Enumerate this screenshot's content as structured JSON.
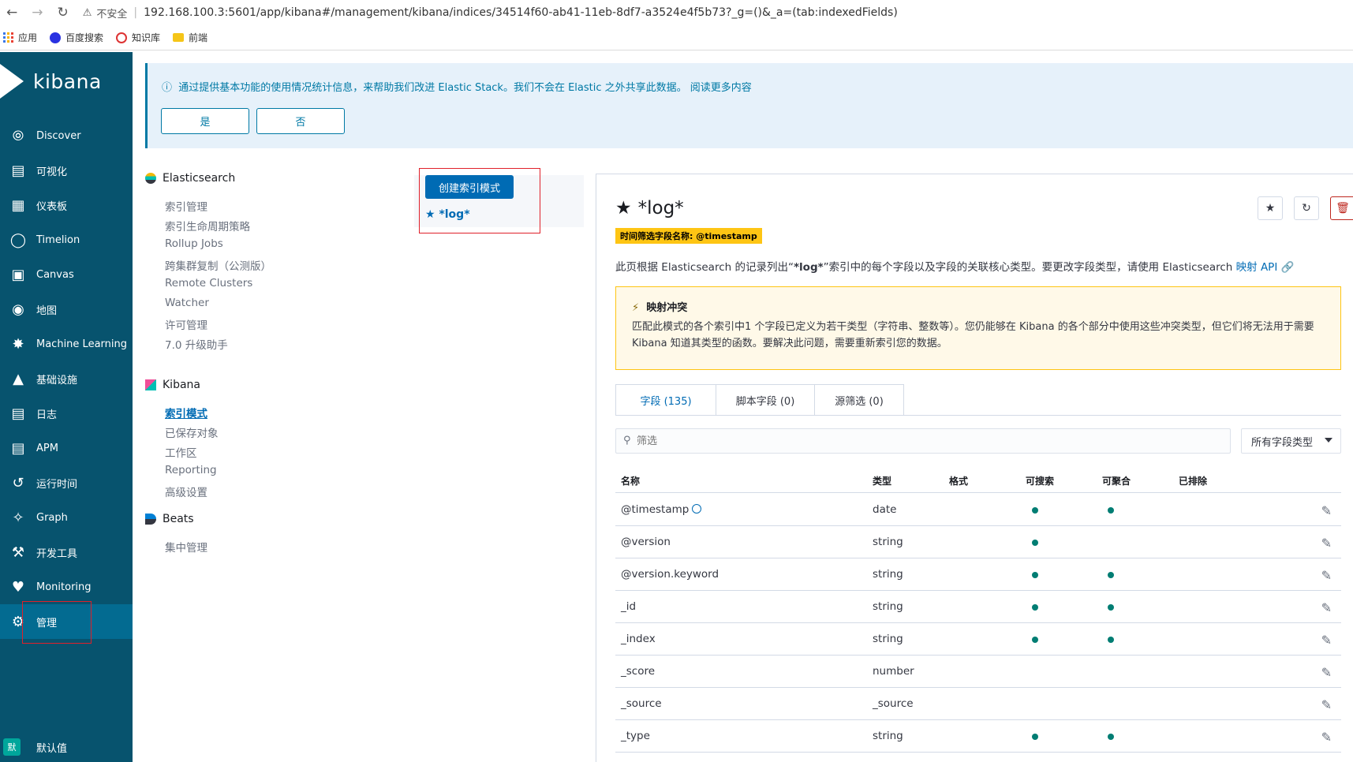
{
  "browser": {
    "insecure_label": "不安全",
    "url": "192.168.100.3:5601/app/kibana#/management/kibana/indices/34514f60-ab41-11eb-8df7-a3524e4f5b73?_g=()&_a=(tab:indexedFields)",
    "bookmarks": [
      "应用",
      "百度搜索",
      "知识库",
      "前端"
    ]
  },
  "sidebar": {
    "logo": "kibana",
    "items": [
      {
        "label": "Discover",
        "icon": "compass-icon"
      },
      {
        "label": "可视化",
        "icon": "visualize-icon"
      },
      {
        "label": "仪表板",
        "icon": "dashboard-icon"
      },
      {
        "label": "Timelion",
        "icon": "timelion-icon"
      },
      {
        "label": "Canvas",
        "icon": "canvas-icon"
      },
      {
        "label": "地图",
        "icon": "maps-icon"
      },
      {
        "label": "Machine Learning",
        "icon": "ml-icon"
      },
      {
        "label": "基础设施",
        "icon": "infra-icon"
      },
      {
        "label": "日志",
        "icon": "logs-icon"
      },
      {
        "label": "APM",
        "icon": "apm-icon"
      },
      {
        "label": "运行时间",
        "icon": "uptime-icon"
      },
      {
        "label": "Graph",
        "icon": "graph-icon"
      },
      {
        "label": "开发工具",
        "icon": "devtools-icon"
      },
      {
        "label": "Monitoring",
        "icon": "monitoring-icon"
      },
      {
        "label": "管理",
        "icon": "gear-icon"
      }
    ],
    "space_badge": "默",
    "space_label": "默认值"
  },
  "callout": {
    "message": "通过提供基本功能的使用情况统计信息，来帮助我们改进 Elastic Stack。我们不会在 Elastic 之外共享此数据。 阅读更多内容",
    "yes": "是",
    "no": "否"
  },
  "management_menu": {
    "elasticsearch": {
      "title": "Elasticsearch",
      "items": [
        "索引管理",
        "索引生命周期策略",
        "Rollup Jobs",
        "跨集群复制（公测版）",
        "Remote Clusters",
        "Watcher",
        "许可管理",
        "7.0 升级助手"
      ]
    },
    "kibana": {
      "title": "Kibana",
      "items": [
        "索引模式",
        "已保存对象",
        "工作区",
        "Reporting",
        "高级设置"
      ]
    },
    "beats": {
      "title": "Beats",
      "items": [
        "集中管理"
      ]
    }
  },
  "index_patterns": {
    "create_button": "创建索引模式",
    "pattern": "*log*"
  },
  "detail": {
    "title": "*log*",
    "time_badge": "时间筛选字段名称: @timestamp",
    "desc_prefix": "此页根据 Elasticsearch 的记录列出“",
    "desc_bold": "*log*",
    "desc_mid": "”索引中的每个字段以及字段的关联核心类型。要更改字段类型，请使用 Elasticsearch ",
    "desc_link": "映射 API",
    "warning_title": "映射冲突",
    "warning_body": "匹配此模式的各个索引中1 个字段已定义为若干类型（字符串、整数等）。您仍能够在 Kibana 的各个部分中使用这些冲突类型，但它们将无法用于需要 Kibana 知道其类型的函数。要解决此问题，需要重新索引您的数据。",
    "tabs": [
      "字段 (135)",
      "脚本字段 (0)",
      "源筛选 (0)"
    ],
    "filter_placeholder": "筛选",
    "type_select": "所有字段类型",
    "columns": [
      "名称",
      "类型",
      "格式",
      "可搜索",
      "可聚合",
      "已排除"
    ],
    "rows": [
      {
        "name": "@timestamp",
        "type": "date",
        "searchable": true,
        "aggregatable": true,
        "time": true
      },
      {
        "name": "@version",
        "type": "string",
        "searchable": true,
        "aggregatable": false
      },
      {
        "name": "@version.keyword",
        "type": "string",
        "searchable": true,
        "aggregatable": true
      },
      {
        "name": "_id",
        "type": "string",
        "searchable": true,
        "aggregatable": true
      },
      {
        "name": "_index",
        "type": "string",
        "searchable": true,
        "aggregatable": true
      },
      {
        "name": "_score",
        "type": "number",
        "searchable": false,
        "aggregatable": false
      },
      {
        "name": "_source",
        "type": "_source",
        "searchable": false,
        "aggregatable": false
      },
      {
        "name": "_type",
        "type": "string",
        "searchable": true,
        "aggregatable": true
      }
    ]
  }
}
